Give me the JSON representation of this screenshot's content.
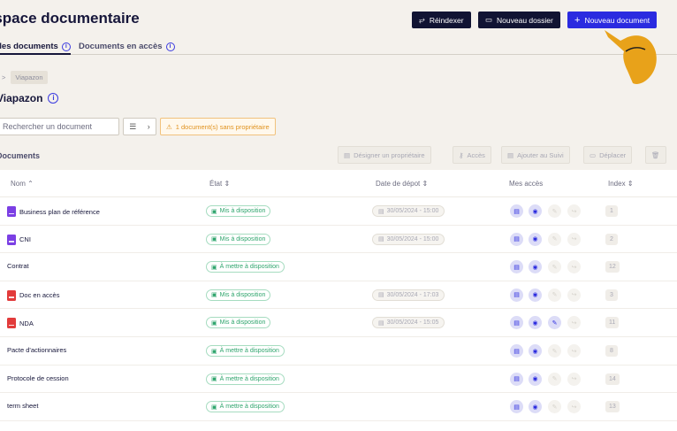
{
  "header": {
    "title": "Espace documentaire",
    "buttons": {
      "reindex": "Réindexer",
      "new_folder": "Nouveau dossier",
      "new_document": "Nouveau document"
    }
  },
  "tabs": [
    {
      "label": "Mes documents"
    },
    {
      "label": "Documents en accès"
    }
  ],
  "breadcrumb": {
    "separator": ">",
    "item": "Viapazon"
  },
  "folder_title": "Viapazon",
  "search": {
    "placeholder": "Rechercher un document"
  },
  "warning": "1 document(s) sans propriétaire",
  "section_title": "Documents",
  "actions": {
    "assign_owner": "Désigner un propriétaire",
    "access": "Accès",
    "add_followup": "Ajouter au Suivi",
    "move": "Déplacer"
  },
  "columns": {
    "name": "Nom",
    "state": "État",
    "date": "Date de dépot",
    "access": "Mes accès",
    "index": "Index"
  },
  "rows": [
    {
      "name": "Business plan de référence",
      "icon": "doc",
      "state": "Mis à disposition",
      "date": "30/05/2024 - 15:00",
      "edit_on": false,
      "index": "1"
    },
    {
      "name": "CNI",
      "icon": "doc",
      "state": "Mis à disposition",
      "date": "30/05/2024 - 15:00",
      "edit_on": false,
      "index": "2"
    },
    {
      "name": "Contrat",
      "icon": "",
      "state": "À mettre à disposition",
      "date": "",
      "edit_on": false,
      "index": "12"
    },
    {
      "name": "Doc en accès",
      "icon": "pdf",
      "state": "Mis à disposition",
      "date": "30/05/2024 - 17:03",
      "edit_on": false,
      "index": "3"
    },
    {
      "name": "NDA",
      "icon": "pdf",
      "state": "Mis à disposition",
      "date": "30/05/2024 - 15:05",
      "edit_on": true,
      "index": "11"
    },
    {
      "name": "Pacte d'actionnaires",
      "icon": "",
      "state": "À mettre à disposition",
      "date": "",
      "edit_on": false,
      "index": "8"
    },
    {
      "name": "Protocole de cession",
      "icon": "",
      "state": "À mettre à disposition",
      "date": "",
      "edit_on": false,
      "index": "14"
    },
    {
      "name": "term sheet",
      "icon": "",
      "state": "À mettre à disposition",
      "date": "",
      "edit_on": false,
      "index": "13"
    }
  ],
  "colors": {
    "primary": "#2b2be0",
    "dark": "#111433",
    "success": "#2fa56d",
    "warning": "#e0921e",
    "cursor": "#e8a21a"
  }
}
